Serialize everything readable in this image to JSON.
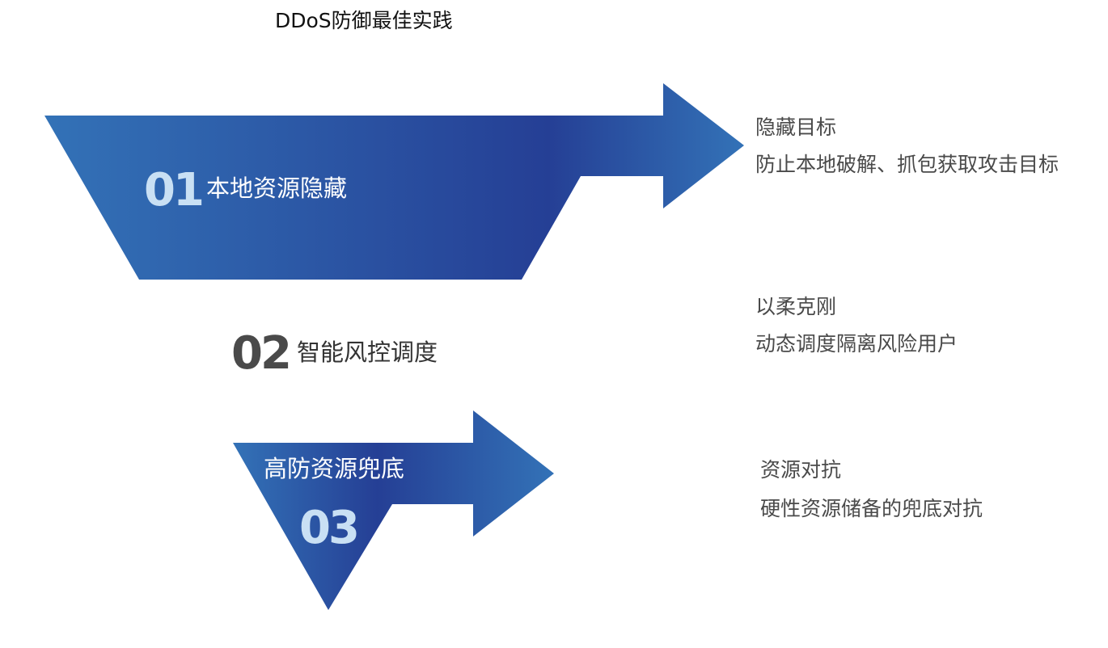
{
  "title": "DDoS防御最佳实践",
  "steps": [
    {
      "number": "01",
      "label": "本地资源隐藏",
      "desc_title": "隐藏目标",
      "desc_text": "防止本地破解、抓包获取攻击目标"
    },
    {
      "number": "02",
      "label": "智能风控调度",
      "desc_title": "以柔克刚",
      "desc_text": "动态调度隔离风险用户"
    },
    {
      "number": "03",
      "label": "高防资源兜底",
      "desc_title": "资源对抗",
      "desc_text": "硬性资源储备的兜底对抗"
    }
  ],
  "colors": {
    "gradient_light": "#3372b7",
    "gradient_dark": "#253f95",
    "number_light": "#c9e0f4",
    "number_dark": "#4a4a4a",
    "text_gray": "#4a4a4a"
  }
}
